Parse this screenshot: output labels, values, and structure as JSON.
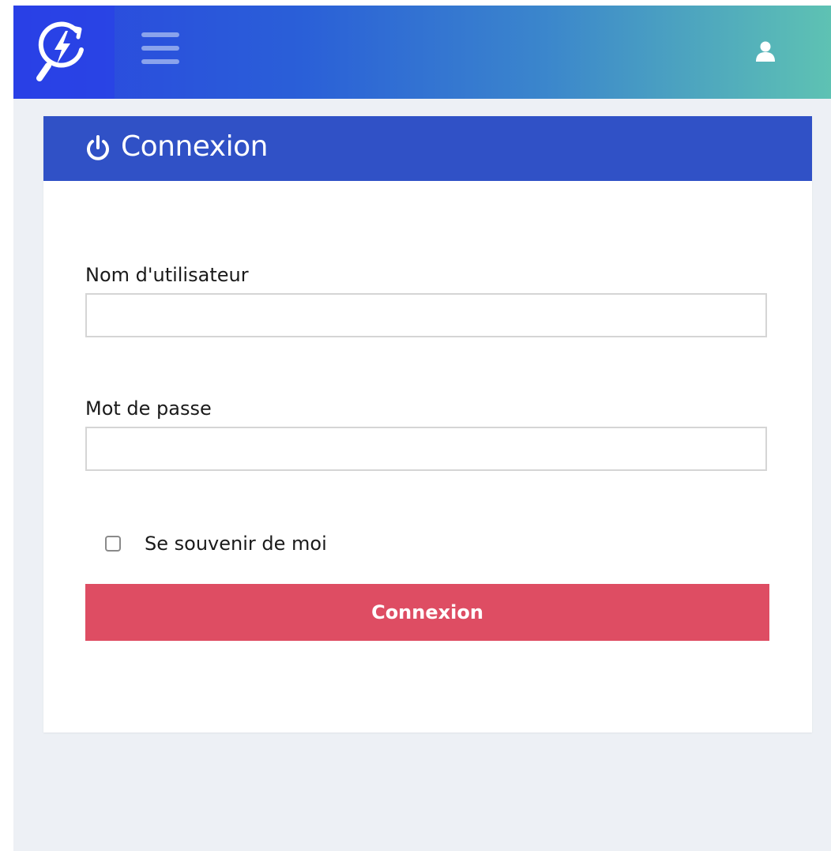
{
  "colors": {
    "topbar_gradient_start": "#2b45e0",
    "topbar_gradient_end": "#5ec2b3",
    "card_header": "#3051c6",
    "submit_button": "#de4d63",
    "page_background": "#edf0f5"
  },
  "topbar": {
    "logo_icon": "lightning-refresh-search-icon",
    "menu_icon": "hamburger-menu-icon",
    "user_icon": "user-icon"
  },
  "login_card": {
    "header_icon": "power-icon",
    "title": "Connexion",
    "username": {
      "label": "Nom d'utilisateur",
      "value": ""
    },
    "password": {
      "label": "Mot de passe",
      "value": ""
    },
    "remember_me": {
      "label": "Se souvenir de moi",
      "checked": false
    },
    "submit_label": "Connexion"
  }
}
